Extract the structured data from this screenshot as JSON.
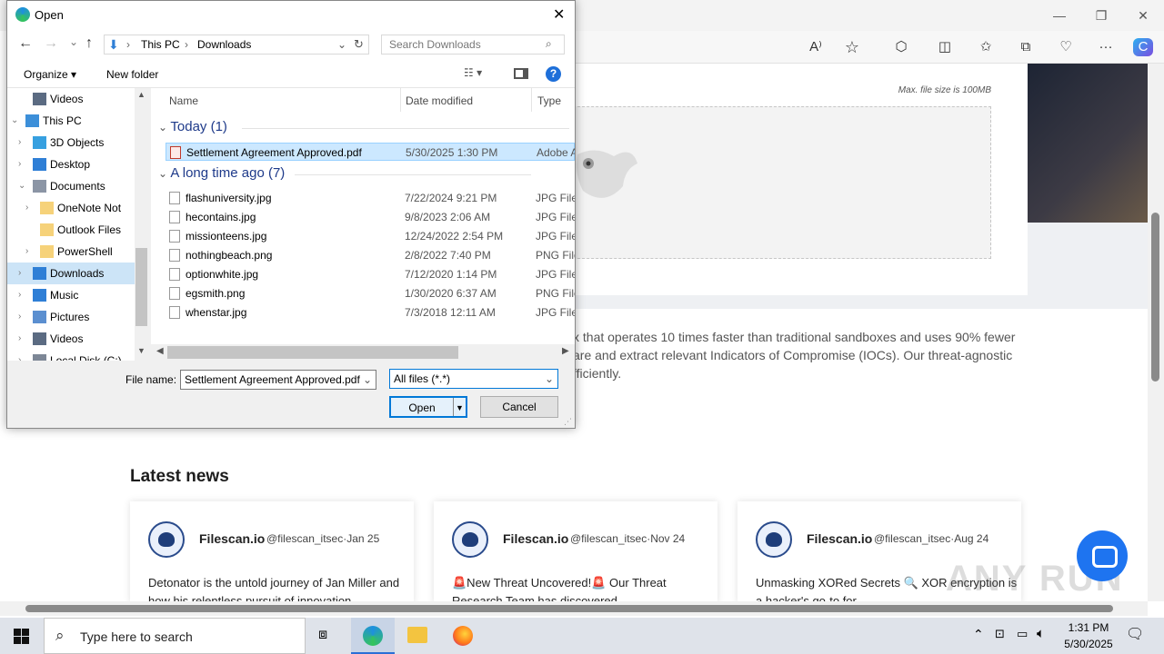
{
  "browser": {
    "window_controls": {
      "minimize": "—",
      "maximize": "❐",
      "close": "✕"
    },
    "toolbar_icons": [
      "read-aloud-icon",
      "favorite-star-icon",
      "extensions-icon",
      "split-screen-icon",
      "favorites-icon",
      "collections-icon",
      "performance-icon",
      "more-icon",
      "copilot-icon"
    ],
    "read_aloud_glyph": "A⁾",
    "star_glyph": "☆",
    "more_glyph": "···"
  },
  "page": {
    "max_file_size": "Max. file size is 100MB",
    "description_lines": [
      "x that operates 10 times faster than traditional sandboxes and uses 90% fewer",
      "are and extract relevant Indicators of Compromise (IOCs). Our threat-agnostic",
      "fficiently."
    ],
    "news_title": "Latest news",
    "cards": [
      {
        "name": "Filescan.io",
        "handle": "@filescan_itsec·Jan 25",
        "text": "Detonator is the untold journey of Jan Miller and how his relentless pursuit of innovation"
      },
      {
        "name": "Filescan.io",
        "handle": "@filescan_itsec·Nov 24",
        "text": "🚨New Threat Uncovered!🚨 Our Threat Research Team has discovered"
      },
      {
        "name": "Filescan.io",
        "handle": "@filescan_itsec·Aug 24",
        "text": "Unmasking XORed Secrets 🔍 XOR encryption is a hacker's go-to for"
      }
    ],
    "watermark": "ANY RUN"
  },
  "dialog": {
    "title": "Open",
    "close": "✕",
    "nav": {
      "back": "←",
      "forward": "→",
      "dropdown": "⌄",
      "up": "↑",
      "path": [
        "This PC",
        "Downloads"
      ],
      "sep": "›",
      "refresh": "↻",
      "search_placeholder": "Search Downloads"
    },
    "toolbar": {
      "organize": "Organize ▾",
      "new_folder": "New folder",
      "view": "☷ ▾",
      "help": "?"
    },
    "tree": [
      {
        "label": "Videos",
        "indent": 2,
        "arrow": "",
        "color": "#5b6b82"
      },
      {
        "label": "This PC",
        "indent": 1,
        "arrow": "⌄",
        "color": "#3c8fd9"
      },
      {
        "label": "3D Objects",
        "indent": 2,
        "arrow": "›",
        "color": "#37a0e0"
      },
      {
        "label": "Desktop",
        "indent": 2,
        "arrow": "›",
        "color": "#2f7fd6"
      },
      {
        "label": "Documents",
        "indent": 2,
        "arrow": "⌄",
        "color": "#8b95a5"
      },
      {
        "label": "OneNote Not",
        "indent": 3,
        "arrow": "›",
        "color": "#f6d27a"
      },
      {
        "label": "Outlook Files",
        "indent": 3,
        "arrow": "",
        "color": "#f6d27a"
      },
      {
        "label": "PowerShell",
        "indent": 3,
        "arrow": "›",
        "color": "#f6d27a"
      },
      {
        "label": "Downloads",
        "indent": 2,
        "arrow": "›",
        "color": "#2f7fd6",
        "selected": true
      },
      {
        "label": "Music",
        "indent": 2,
        "arrow": "›",
        "color": "#2f7fd6"
      },
      {
        "label": "Pictures",
        "indent": 2,
        "arrow": "›",
        "color": "#5b8fd0"
      },
      {
        "label": "Videos",
        "indent": 2,
        "arrow": "›",
        "color": "#5b6b82"
      },
      {
        "label": "Local Disk (C:)",
        "indent": 2,
        "arrow": "›",
        "color": "#7d8796"
      }
    ],
    "columns": {
      "name": "Name",
      "date": "Date modified",
      "type": "Type"
    },
    "groups": [
      {
        "label": "Today (1)",
        "files": [
          {
            "name": "Settlement Agreement Approved.pdf",
            "date": "5/30/2025 1:30 PM",
            "type": "Adobe A",
            "selected": true,
            "pdf": true
          }
        ]
      },
      {
        "label": "A long time ago (7)",
        "files": [
          {
            "name": "flashuniversity.jpg",
            "date": "7/22/2024 9:21 PM",
            "type": "JPG File"
          },
          {
            "name": "hecontains.jpg",
            "date": "9/8/2023 2:06 AM",
            "type": "JPG File"
          },
          {
            "name": "missionteens.jpg",
            "date": "12/24/2022 2:54 PM",
            "type": "JPG File"
          },
          {
            "name": "nothingbeach.png",
            "date": "2/8/2022 7:40 PM",
            "type": "PNG File"
          },
          {
            "name": "optionwhite.jpg",
            "date": "7/12/2020 1:14 PM",
            "type": "JPG File"
          },
          {
            "name": "egsmith.png",
            "date": "1/30/2020 6:37 AM",
            "type": "PNG File"
          },
          {
            "name": "whenstar.jpg",
            "date": "7/3/2018 12:11 AM",
            "type": "JPG File"
          }
        ]
      }
    ],
    "filename_label": "File name:",
    "filename_value": "Settlement Agreement Approved.pdf",
    "filetype_value": "All files (*.*)",
    "open": "Open",
    "cancel": "Cancel"
  },
  "taskbar": {
    "search_placeholder": "Type here to search",
    "time": "1:31 PM",
    "date": "5/30/2025"
  }
}
